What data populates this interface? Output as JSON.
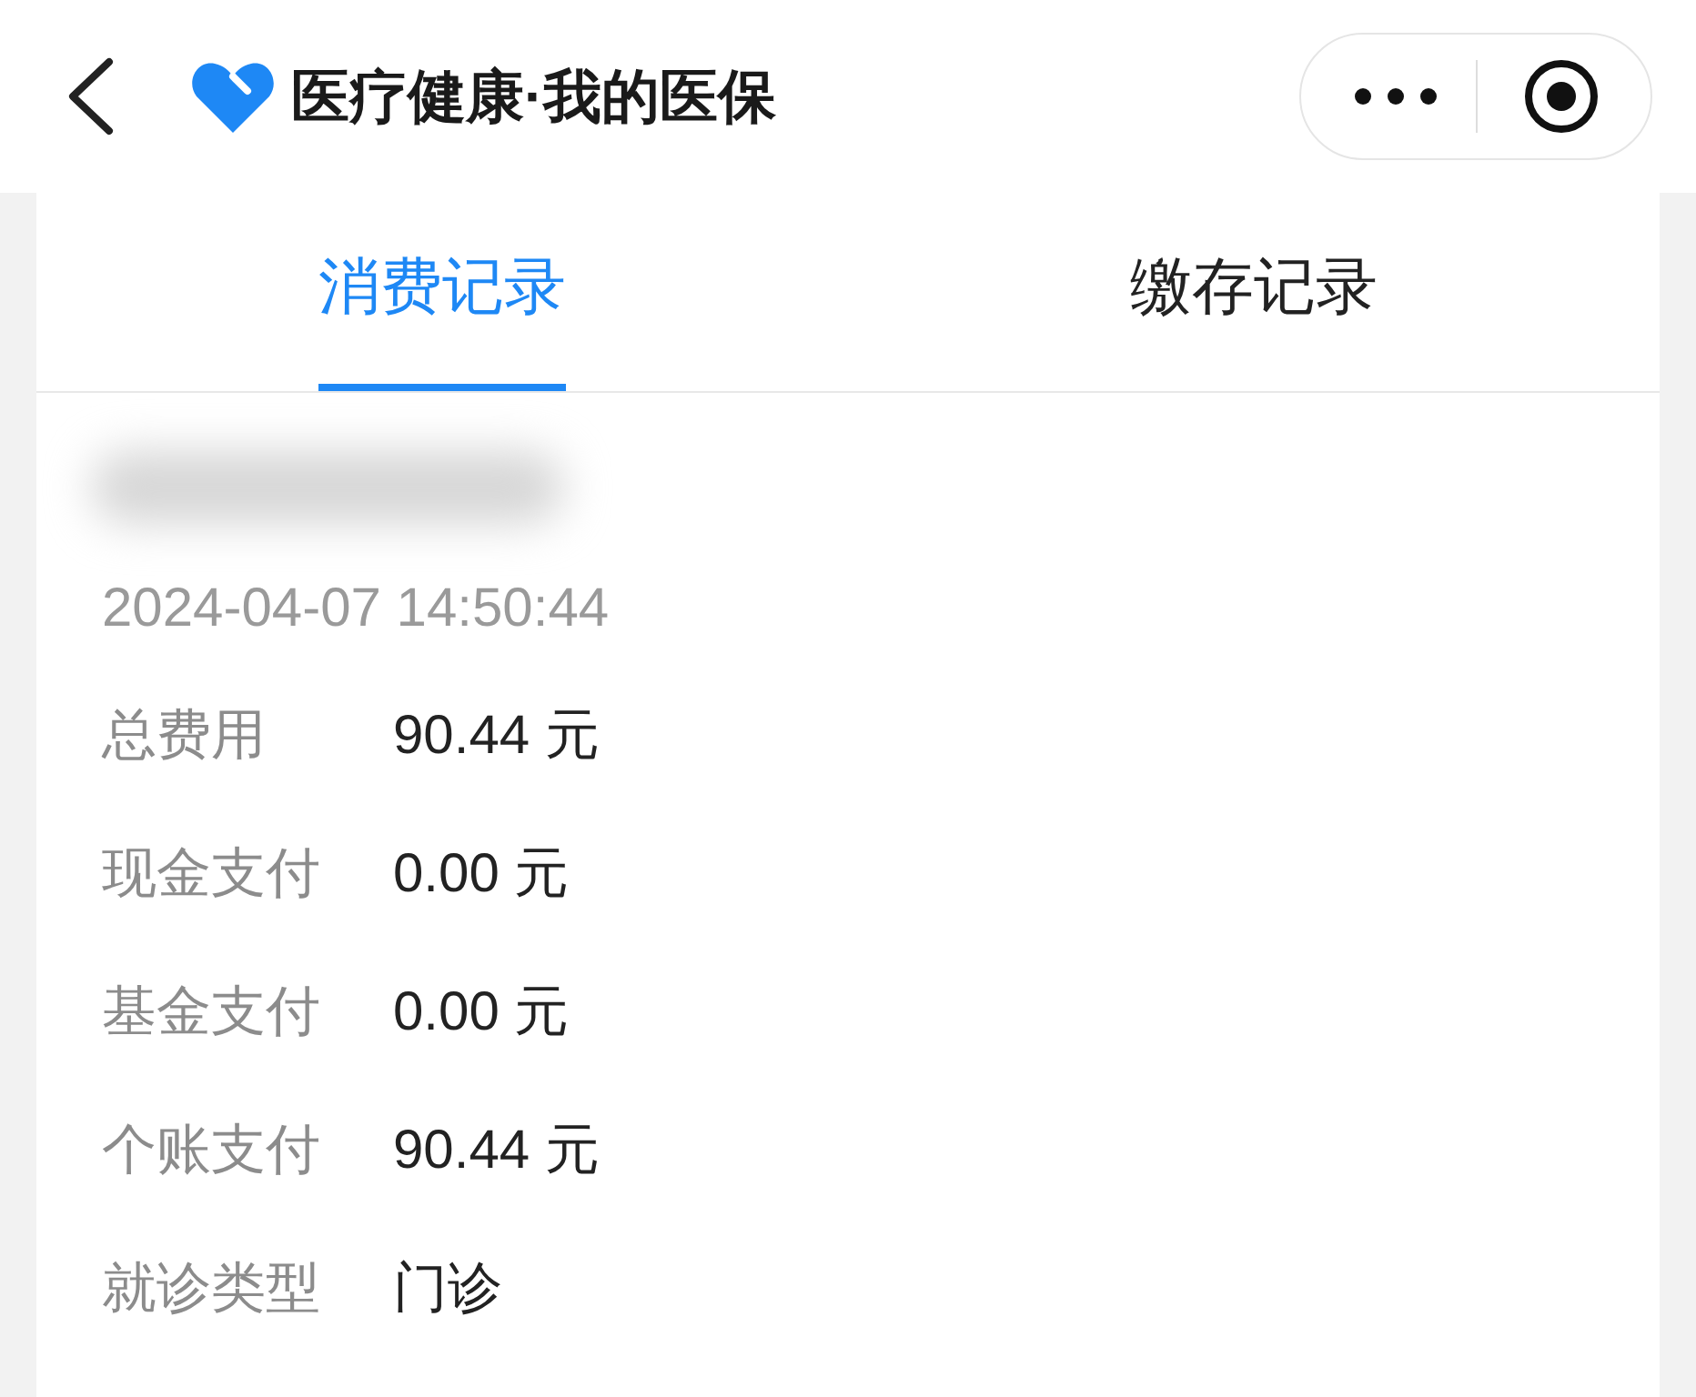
{
  "header": {
    "title": "医疗健康·我的医保"
  },
  "tabs": [
    {
      "label": "消费记录",
      "selected": true
    },
    {
      "label": "缴存记录",
      "selected": false
    }
  ],
  "record": {
    "datetime": "2024-04-07 14:50:44",
    "fields": [
      {
        "label": "总费用",
        "value": "90.44 元"
      },
      {
        "label": "现金支付",
        "value": "0.00 元"
      },
      {
        "label": "基金支付",
        "value": "0.00 元"
      },
      {
        "label": "个账支付",
        "value": "90.44 元"
      },
      {
        "label": "就诊类型",
        "value": "门诊"
      }
    ]
  }
}
